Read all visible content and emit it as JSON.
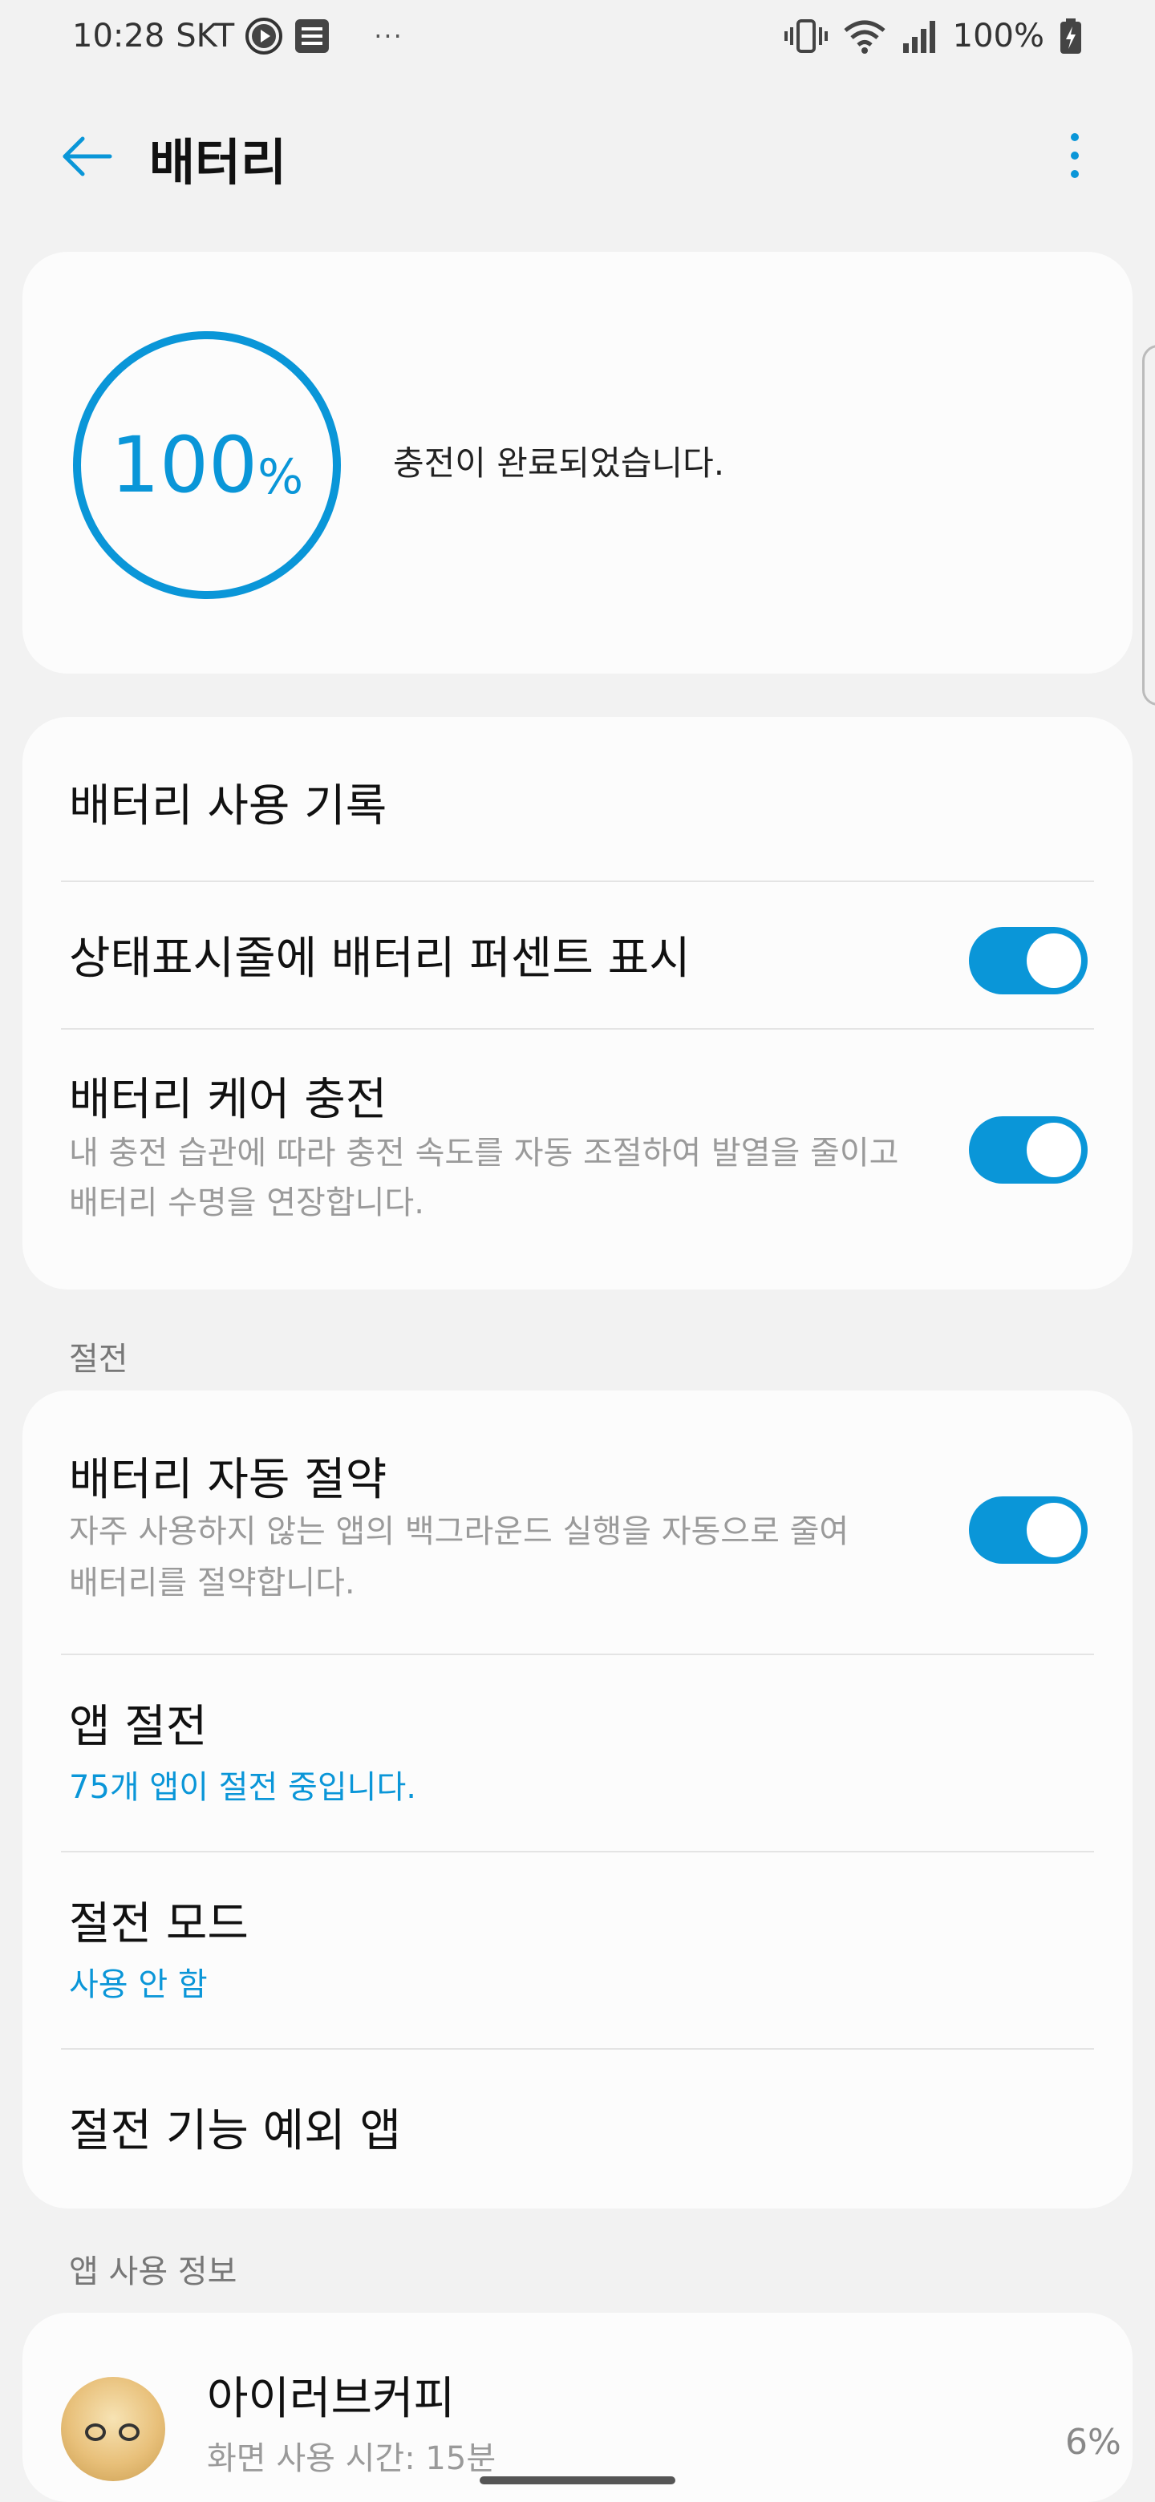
{
  "status_bar": {
    "time": "10:28",
    "carrier": "SKT",
    "more_dots": "···",
    "battery_percent": "100%"
  },
  "app_bar": {
    "title": "배터리"
  },
  "battery_status": {
    "level_value": "100",
    "level_unit": "%",
    "level_fraction": 1.0,
    "message": "충전이 완료되었습니다."
  },
  "settings": {
    "usage_history": "배터리 사용 기록",
    "show_percent": {
      "label": "상태표시줄에 배터리 퍼센트 표시",
      "enabled": true
    },
    "battery_care": {
      "label": "배터리 케어 충전",
      "desc_line1": "내 충전 습관에 따라 충전 속도를 자동 조절하여 발열을 줄이고",
      "desc_line2": "배터리 수명을 연장합니다.",
      "enabled": true
    }
  },
  "power_saving": {
    "section_label": "절전",
    "auto_saving": {
      "label": "배터리 자동 절약",
      "desc_line1": "자주 사용하지 않는 앱의 백그라운드 실행을 자동으로 줄여",
      "desc_line2": "배터리를 절약합니다.",
      "enabled": true
    },
    "app_saving": {
      "label": "앱 절전",
      "value": "75개 앱이 절전 중입니다."
    },
    "saving_mode": {
      "label": "절전 모드",
      "value": "사용 안 함"
    },
    "exception_apps": {
      "label": "절전 기능 예외 앱"
    }
  },
  "app_usage": {
    "section_label": "앱 사용 정보",
    "items": [
      {
        "name": "아이러브커피",
        "detail": "화면 사용 시간: 15분",
        "percent": "6%"
      }
    ]
  },
  "colors": {
    "accent": "#0a96d8",
    "background": "#f2f2f2",
    "card": "#fcfcfc"
  }
}
